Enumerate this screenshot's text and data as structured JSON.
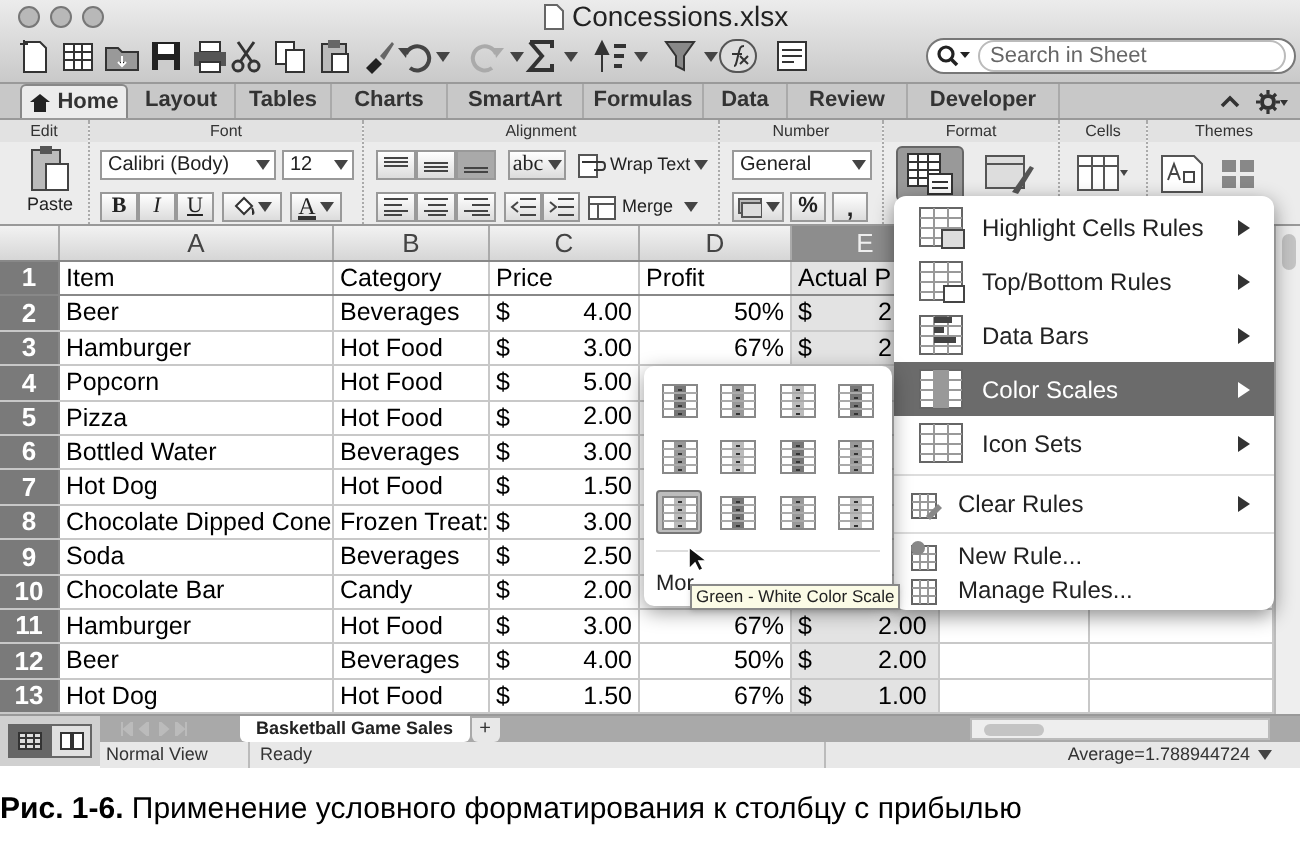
{
  "window": {
    "title": "Concessions.xlsx"
  },
  "search": {
    "placeholder": "Search in Sheet"
  },
  "tabs": [
    {
      "label": "Home",
      "selected": true
    },
    {
      "label": "Layout",
      "selected": false
    },
    {
      "label": "Tables",
      "selected": false
    },
    {
      "label": "Charts",
      "selected": false
    },
    {
      "label": "SmartArt",
      "selected": false
    },
    {
      "label": "Formulas",
      "selected": false
    },
    {
      "label": "Data",
      "selected": false
    },
    {
      "label": "Review",
      "selected": false
    },
    {
      "label": "Developer",
      "selected": false
    }
  ],
  "ribbon": {
    "groups": [
      "Edit",
      "Font",
      "Alignment",
      "Number",
      "Format",
      "Cells",
      "Themes"
    ],
    "paste": "Paste",
    "font": "Calibri (Body)",
    "size": "12",
    "styles": [
      "B",
      "I",
      "U"
    ],
    "font_color": "A",
    "vertical_align": [
      {
        "selected": false
      },
      {
        "selected": false
      },
      {
        "selected": true
      }
    ],
    "orientation": "abc",
    "wrap": "Wrap Text",
    "merge": "Merge",
    "number_format": "General",
    "percent": "%",
    "comma": ","
  },
  "columns": [
    {
      "label": "A",
      "selected": false
    },
    {
      "label": "B",
      "selected": false
    },
    {
      "label": "C",
      "selected": false
    },
    {
      "label": "D",
      "selected": false
    },
    {
      "label": "E",
      "selected": true
    }
  ],
  "header_row": {
    "number": "1",
    "selected": true,
    "cells": [
      "Item",
      "Category",
      "Price",
      "Profit",
      "Actual P"
    ]
  },
  "rows": [
    {
      "number": "2",
      "selected": true,
      "item": "Beer",
      "category": "Beverages",
      "price_currency": "$",
      "price": "4.00",
      "profit": "50%",
      "actual_currency": "$",
      "actual": "2"
    },
    {
      "number": "3",
      "selected": true,
      "item": "Hamburger",
      "category": "Hot Food",
      "price_currency": "$",
      "price": "3.00",
      "profit": "67%",
      "actual_currency": "$",
      "actual": "2"
    },
    {
      "number": "4",
      "selected": true,
      "item": "Popcorn",
      "category": "Hot Food",
      "price_currency": "$",
      "price": "5.00"
    },
    {
      "number": "5",
      "selected": true,
      "item": "Pizza",
      "category": "Hot Food",
      "price_currency": "$",
      "price": "2.00"
    },
    {
      "number": "6",
      "selected": true,
      "item": "Bottled Water",
      "category": "Beverages",
      "price_currency": "$",
      "price": "3.00"
    },
    {
      "number": "7",
      "selected": true,
      "item": "Hot Dog",
      "category": "Hot Food",
      "price_currency": "$",
      "price": "1.50"
    },
    {
      "number": "8",
      "selected": true,
      "item": "Chocolate Dipped Cone",
      "category": "Frozen Treat:",
      "price_currency": "$",
      "price": "3.00"
    },
    {
      "number": "9",
      "selected": true,
      "item": "Soda",
      "category": "Beverages",
      "price_currency": "$",
      "price": "2.50"
    },
    {
      "number": "10",
      "selected": true,
      "item": "Chocolate Bar",
      "category": "Candy",
      "price_currency": "$",
      "price": "2.00"
    },
    {
      "number": "11",
      "selected": true,
      "item": "Hamburger",
      "category": "Hot Food",
      "price_currency": "$",
      "price": "3.00",
      "profit": "67%",
      "actual_currency": "$",
      "actual": "2.00"
    },
    {
      "number": "12",
      "selected": true,
      "item": "Beer",
      "category": "Beverages",
      "price_currency": "$",
      "price": "4.00",
      "profit": "50%",
      "actual_currency": "$",
      "actual": "2.00"
    },
    {
      "number": "13",
      "selected": true,
      "item": "Hot Dog",
      "category": "Hot Food",
      "price_currency": "$",
      "price": "1.50",
      "profit": "67%",
      "actual_currency": "$",
      "actual": "1.00"
    }
  ],
  "view_buttons": [
    {
      "selected": true
    },
    {
      "selected": false
    }
  ],
  "sheet_tabs": [
    {
      "label": "Basketball Game Sales",
      "selected": true
    }
  ],
  "add_sheet": "+",
  "status_bar": {
    "view": "Normal View",
    "mode": "Ready",
    "summary": "Average=1.788944724"
  },
  "format_menu": [
    {
      "label": "Highlight Cells Rules",
      "submenu": true,
      "selected": false
    },
    {
      "label": "Top/Bottom Rules",
      "submenu": true,
      "selected": false
    },
    {
      "label": "Data Bars",
      "submenu": true,
      "selected": false
    },
    {
      "label": "Color Scales",
      "submenu": true,
      "selected": true
    },
    {
      "label": "Icon Sets",
      "submenu": true,
      "selected": false
    },
    {
      "label": "Clear Rules",
      "submenu": true,
      "selected": false
    },
    {
      "label": "New Rule...",
      "submenu": false,
      "selected": false
    },
    {
      "label": "Manage Rules...",
      "submenu": false,
      "selected": false
    }
  ],
  "color_scales": {
    "swatches": [
      {
        "selected": false
      },
      {
        "selected": false
      },
      {
        "selected": false
      },
      {
        "selected": false
      },
      {
        "selected": false
      },
      {
        "selected": false
      },
      {
        "selected": false
      },
      {
        "selected": false
      },
      {
        "selected": true
      },
      {
        "selected": false
      },
      {
        "selected": false
      },
      {
        "selected": false
      }
    ],
    "more": "Mor",
    "tooltip": "Green - White Color Scale"
  },
  "caption": "**Рис. 1-6.** Применение условного форматирования к столбцу с прибылью"
}
